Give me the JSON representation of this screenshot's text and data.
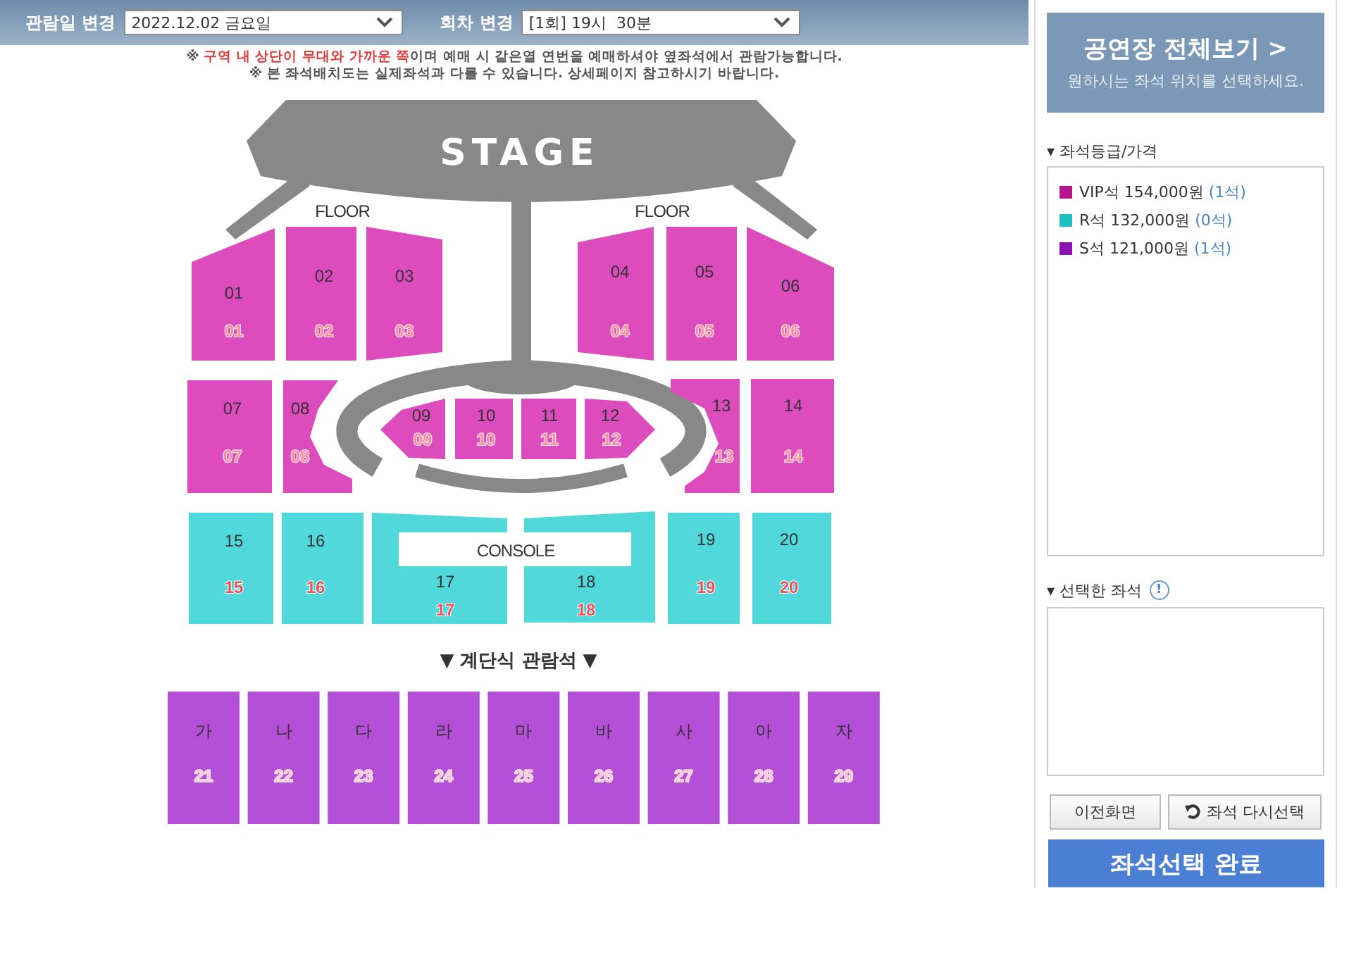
{
  "header": {
    "date_label": "관람일 변경",
    "date_value": "2022.12.02 금요일",
    "round_label": "회차 변경",
    "round_value": "[1회] 19시  30분"
  },
  "notices": [
    {
      "segments": [
        {
          "text": "※ ",
          "highlight": false
        },
        {
          "text": "구역 내 상단이 무대와 가까운 쪽",
          "highlight": true
        },
        {
          "text": "이며 예매 시 같은열 연번을 예매하셔야 옆좌석에서 관람가능합니다.",
          "highlight": false
        }
      ]
    },
    {
      "segments": [
        {
          "text": "※ 본 좌석배치도는 실제좌석과 다를 수 있습니다. 상세페이지 참고하시기 바랍니다.",
          "highlight": false
        }
      ]
    }
  ],
  "map": {
    "stage_label": "STAGE",
    "floor_labels": [
      "FLOOR",
      "FLOOR"
    ],
    "console_label": "CONSOLE",
    "tier_label": "▼ 계단식 관람석 ▼",
    "sections": [
      {
        "label": "01",
        "number": "01",
        "kind": "vip"
      },
      {
        "label": "02",
        "number": "02",
        "kind": "vip"
      },
      {
        "label": "03",
        "number": "03",
        "kind": "vip"
      },
      {
        "label": "04",
        "number": "04",
        "kind": "vip"
      },
      {
        "label": "05",
        "number": "05",
        "kind": "vip"
      },
      {
        "label": "06",
        "number": "06",
        "kind": "vip"
      },
      {
        "label": "07",
        "number": "07",
        "kind": "vip"
      },
      {
        "label": "08",
        "number": "08",
        "kind": "vip"
      },
      {
        "label": "09",
        "number": "09",
        "kind": "vip"
      },
      {
        "label": "10",
        "number": "10",
        "kind": "vip"
      },
      {
        "label": "11",
        "number": "11",
        "kind": "vip"
      },
      {
        "label": "12",
        "number": "12",
        "kind": "vip"
      },
      {
        "label": "13",
        "number": "13",
        "kind": "vip"
      },
      {
        "label": "14",
        "number": "14",
        "kind": "vip"
      },
      {
        "label": "15",
        "number": "15",
        "kind": "r"
      },
      {
        "label": "16",
        "number": "16",
        "kind": "r"
      },
      {
        "label": "17",
        "number": "17",
        "kind": "r"
      },
      {
        "label": "18",
        "number": "18",
        "kind": "r"
      },
      {
        "label": "19",
        "number": "19",
        "kind": "r"
      },
      {
        "label": "20",
        "number": "20",
        "kind": "r"
      },
      {
        "label": "가",
        "number": "21",
        "kind": "s"
      },
      {
        "label": "나",
        "number": "22",
        "kind": "s"
      },
      {
        "label": "다",
        "number": "23",
        "kind": "s"
      },
      {
        "label": "라",
        "number": "24",
        "kind": "s"
      },
      {
        "label": "마",
        "number": "25",
        "kind": "s"
      },
      {
        "label": "바",
        "number": "26",
        "kind": "s"
      },
      {
        "label": "사",
        "number": "27",
        "kind": "s"
      },
      {
        "label": "아",
        "number": "28",
        "kind": "s"
      },
      {
        "label": "자",
        "number": "29",
        "kind": "s"
      }
    ]
  },
  "sidebar": {
    "overview_title": "공연장 전체보기 >",
    "overview_subtitle": "원하시는 좌석 위치를 선택하세요.",
    "grade_heading": "▾ 좌석등급/가격",
    "grades": [
      {
        "name": "VIP석",
        "price": "154,000원",
        "count": "(1석)",
        "color": "#b5168f"
      },
      {
        "name": "R석",
        "price": "132,000원",
        "count": "(0석)",
        "color": "#1fbfbf"
      },
      {
        "name": "S석",
        "price": "121,000원",
        "count": "(1석)",
        "color": "#8a12b0"
      }
    ],
    "selected_heading": "▾ 선택한 좌석",
    "info_mark": "!",
    "back_button": "이전화면",
    "reset_button": "좌석 다시선택",
    "complete_button": "좌석선택 완료"
  }
}
